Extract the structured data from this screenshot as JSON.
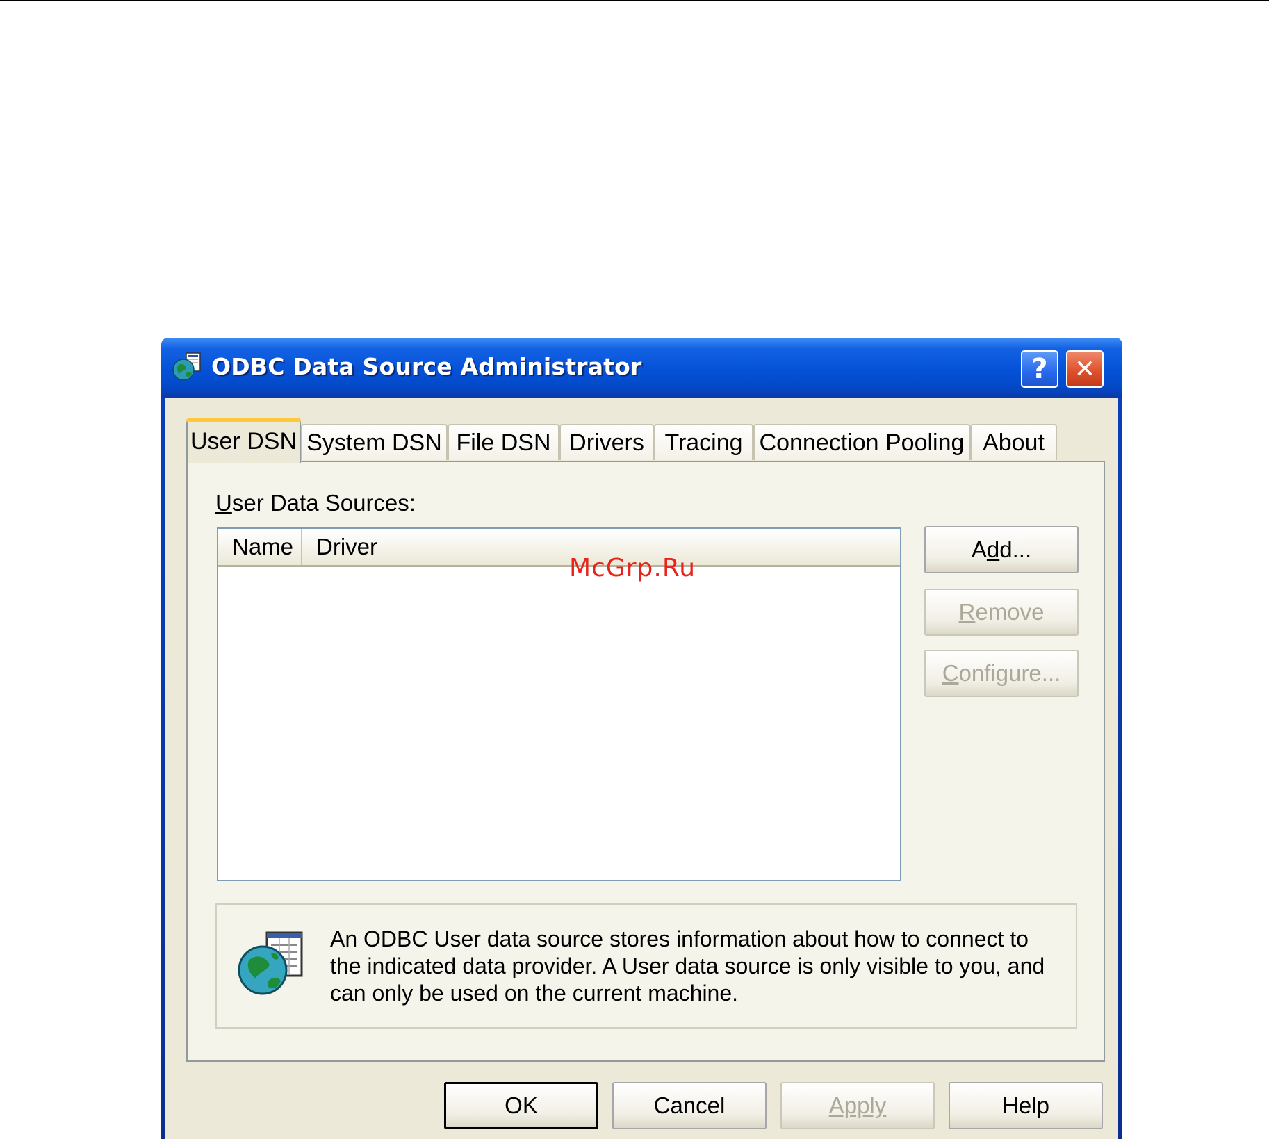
{
  "window": {
    "title": "ODBC Data Source Administrator",
    "help_glyph": "?",
    "close_glyph": "✕",
    "icon": "odbc-globe-icon"
  },
  "tabs": [
    {
      "label": "User DSN",
      "active": true
    },
    {
      "label": "System DSN",
      "active": false
    },
    {
      "label": "File DSN",
      "active": false
    },
    {
      "label": "Drivers",
      "active": false
    },
    {
      "label": "Tracing",
      "active": false
    },
    {
      "label": "Connection Pooling",
      "active": false
    },
    {
      "label": "About",
      "active": false
    }
  ],
  "user_dsn": {
    "label_mnemonic": "U",
    "label_rest": "ser Data Sources:",
    "columns": [
      "Name",
      "Driver"
    ],
    "rows": [],
    "buttons": {
      "add": {
        "pre": "A",
        "mnemonic": "d",
        "post": "d...",
        "enabled": true
      },
      "remove": {
        "pre": "",
        "mnemonic": "R",
        "post": "emove",
        "enabled": false
      },
      "configure": {
        "pre": "",
        "mnemonic": "C",
        "post": "onfigure...",
        "enabled": false
      }
    },
    "info_text": "An ODBC User data source stores information about how to connect to the indicated data provider.   A User data source is only visible to you, and can only be used on the current machine."
  },
  "footer": {
    "ok": "OK",
    "cancel": "Cancel",
    "apply": "Apply",
    "help": "Help"
  },
  "watermark": "McGrp.Ru",
  "colors": {
    "titlebar": "#0653d9",
    "client": "#ece9d8",
    "active_tab_accent": "#ffc83c",
    "close_button": "#e0522d",
    "disabled_text": "#aca899",
    "watermark": "#e8231b"
  }
}
